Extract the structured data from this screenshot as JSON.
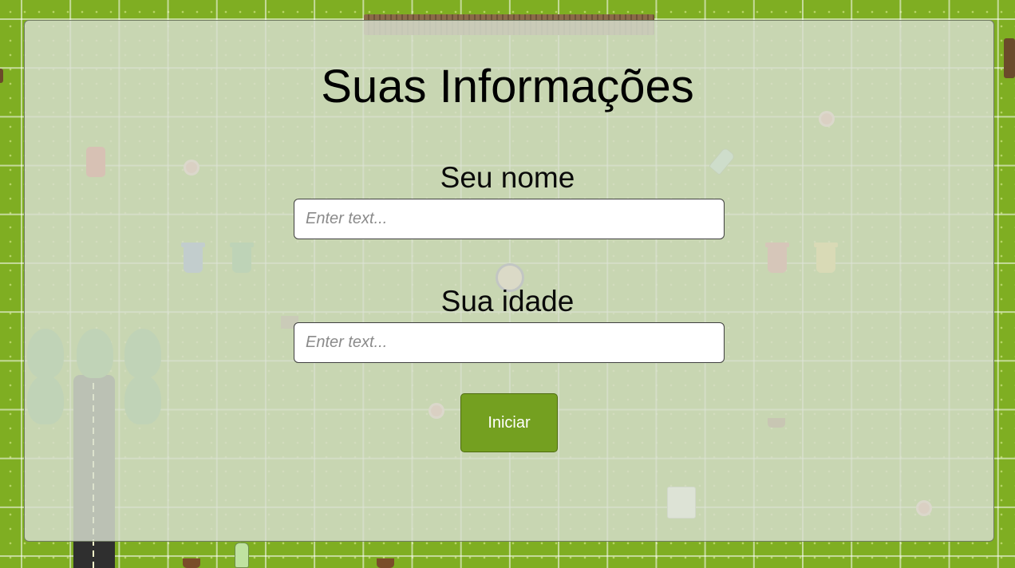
{
  "form": {
    "title": "Suas Informações",
    "name_label": "Seu nome",
    "name_placeholder": "Enter text...",
    "name_value": "",
    "age_label": "Sua idade",
    "age_placeholder": "Enter text...",
    "age_value": "",
    "start_label": "Iniciar"
  },
  "colors": {
    "grass": "#7fae22",
    "panel_overlay": "#d6dece",
    "button": "#74a020",
    "button_text": "#ffffff",
    "title_text": "#000000"
  },
  "icons": [
    "fence-icon",
    "road-icon",
    "tree-icon",
    "trash-bin-icon",
    "flower-icon",
    "soda-can-icon",
    "bottle-icon",
    "plant-pot-icon",
    "paper-roll-icon",
    "child-avatar-icon"
  ]
}
